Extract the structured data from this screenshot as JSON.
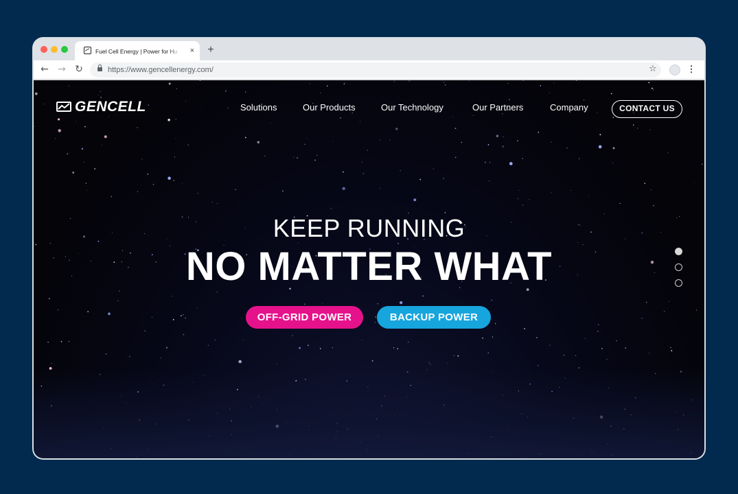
{
  "browser": {
    "tab_title": "Fuel Cell Energy | Power for Hu",
    "tab_close": "×",
    "new_tab": "+",
    "url": "https://www.gencellenergy.com/",
    "back": "←",
    "forward": "→",
    "reload": "↻",
    "bookmark": "☆",
    "menu": "⋮"
  },
  "site": {
    "logo_text": "GENCELL",
    "nav": [
      {
        "label": "Solutions"
      },
      {
        "label": "Our Products"
      },
      {
        "label": "Our Technology"
      },
      {
        "label": "Our Partners"
      },
      {
        "label": "Company"
      }
    ],
    "contact_label": "CONTACT US"
  },
  "hero": {
    "subtitle": "KEEP RUNNING",
    "title": "NO MATTER WHAT",
    "buttons": [
      {
        "label": "OFF-GRID POWER",
        "color": "#e6128c"
      },
      {
        "label": "BACKUP POWER",
        "color": "#17a5dd"
      }
    ],
    "slider": {
      "count": 3,
      "active_index": 0
    }
  },
  "colors": {
    "page_background": "#022a4e",
    "hero_background": "#07081a",
    "accent_pink": "#e6128c",
    "accent_blue": "#17a5dd"
  }
}
